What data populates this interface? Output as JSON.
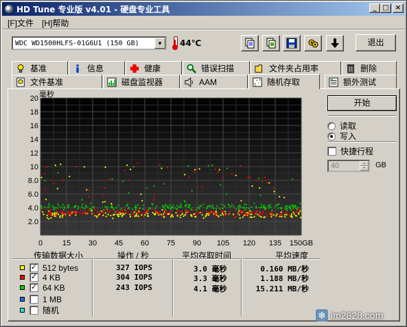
{
  "window": {
    "title": "HD Tune 专业版 v4.01 - 硬盘专业工具",
    "buttons": [
      "_",
      "□",
      "×"
    ]
  },
  "menu": {
    "items": [
      "[F]文件",
      "[H]帮助"
    ]
  },
  "toolbar": {
    "drive": "WDC WD1500HLFS-01G6U1 (150 GB)",
    "temperature": "44℃",
    "exit_label": "退出",
    "icons": [
      "copy-info-icon",
      "copy-screen-icon",
      "save-icon",
      "options-icon",
      "download-icon"
    ]
  },
  "tabs": {
    "row1": [
      {
        "label": "基准",
        "icon": "lightbulb-icon"
      },
      {
        "label": "信息",
        "icon": "info-icon"
      },
      {
        "label": "健康",
        "icon": "red-cross-icon"
      },
      {
        "label": "错误扫描",
        "icon": "magnifier-icon"
      },
      {
        "label": "文件夹占用率",
        "icon": "folder-icon"
      },
      {
        "label": "删除",
        "icon": "trash-icon"
      }
    ],
    "row2": [
      {
        "label": "文件基准",
        "icon": "file-bulb-icon"
      },
      {
        "label": "磁盘监视器",
        "icon": "monitor-chart-icon"
      },
      {
        "label": "AAM",
        "icon": "speaker-icon"
      },
      {
        "label": "随机存取",
        "icon": "random-access-icon",
        "active": true
      },
      {
        "label": "额外测试",
        "icon": "extra-tests-icon"
      }
    ]
  },
  "controls": {
    "start_label": "开始",
    "read_label": "读取",
    "write_label": "写入",
    "selected_mode": "写入",
    "quick_label": "快捷行程",
    "quick_checked": false,
    "quick_value": "40",
    "quick_unit": "GB"
  },
  "chart_data": {
    "type": "scatter",
    "ylabel": "毫秒",
    "ylim": [
      0,
      20
    ],
    "yticks": [
      "2.0",
      "4.0",
      "6.0",
      "8.0",
      "10",
      "12",
      "14",
      "16",
      "18",
      "20"
    ],
    "xlim": [
      0,
      150
    ],
    "xticks": [
      "0",
      "15",
      "30",
      "45",
      "60",
      "75",
      "90",
      "105",
      "120",
      "135",
      "150GB"
    ],
    "grid": true,
    "series": [
      {
        "name": "512 bytes",
        "color": "#ffff00",
        "typical_ms": 3.0
      },
      {
        "name": "4 KB",
        "color": "#ff0000",
        "typical_ms": 3.3
      },
      {
        "name": "64 KB",
        "color": "#00cc00",
        "typical_ms": 4.1
      }
    ]
  },
  "table": {
    "headers": [
      "传输数据大小",
      "操作 / 秒",
      "平均存取时间",
      "平均速度"
    ],
    "rows": [
      {
        "size": "512 bytes",
        "color": "#ffff00",
        "checked": true,
        "ops": "327 IOPS",
        "access": "3.0 毫秒",
        "speed": "0.160 MB/秒"
      },
      {
        "size": "4 KB",
        "color": "#ff0000",
        "checked": true,
        "ops": "304 IOPS",
        "access": "3.3 毫秒",
        "speed": "1.188 MB/秒"
      },
      {
        "size": "64 KB",
        "color": "#00cc00",
        "checked": true,
        "ops": "243 IOPS",
        "access": "4.1 毫秒",
        "speed": "15.211 MB/秒"
      },
      {
        "size": "1 MB",
        "color": "#1e6fdc",
        "checked": false
      },
      {
        "size": "随机",
        "color": "#33dddd",
        "checked": false
      }
    ]
  },
  "watermark": "im2828.com"
}
